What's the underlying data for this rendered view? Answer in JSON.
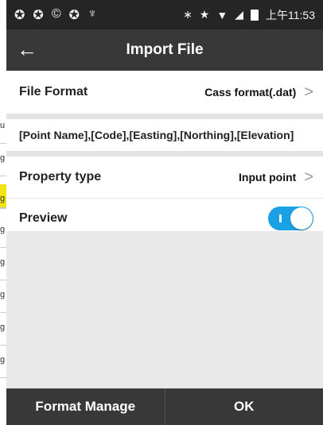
{
  "status_bar": {
    "left_icons": [
      "sync-icon",
      "sync-icon",
      "copyright-icon",
      "sync-icon",
      "usb-icon"
    ],
    "right_icons": [
      "bluetooth-icon",
      "star-icon",
      "wifi-icon",
      "signal-icon",
      "battery-icon"
    ],
    "time": "上午11:53"
  },
  "header": {
    "title": "Import File",
    "back_glyph": "←"
  },
  "file_format": {
    "label": "File Format",
    "value": "Cass format(.dat)"
  },
  "template": {
    "text": "[Point Name],[Code],[Easting],[Northing],[Elevation]"
  },
  "property_type": {
    "label": "Property type",
    "value": "Input point"
  },
  "preview": {
    "label": "Preview",
    "enabled": true
  },
  "buttons": {
    "format_manage": "Format Manage",
    "ok": "OK"
  },
  "background_list": {
    "row_letters": [
      "u",
      "g",
      "g",
      "g",
      "g",
      "g",
      "g",
      "g",
      "g"
    ]
  },
  "colors": {
    "toggle_on": "#1aa0e5",
    "title_bar": "#383838",
    "status_bar": "#252525"
  }
}
